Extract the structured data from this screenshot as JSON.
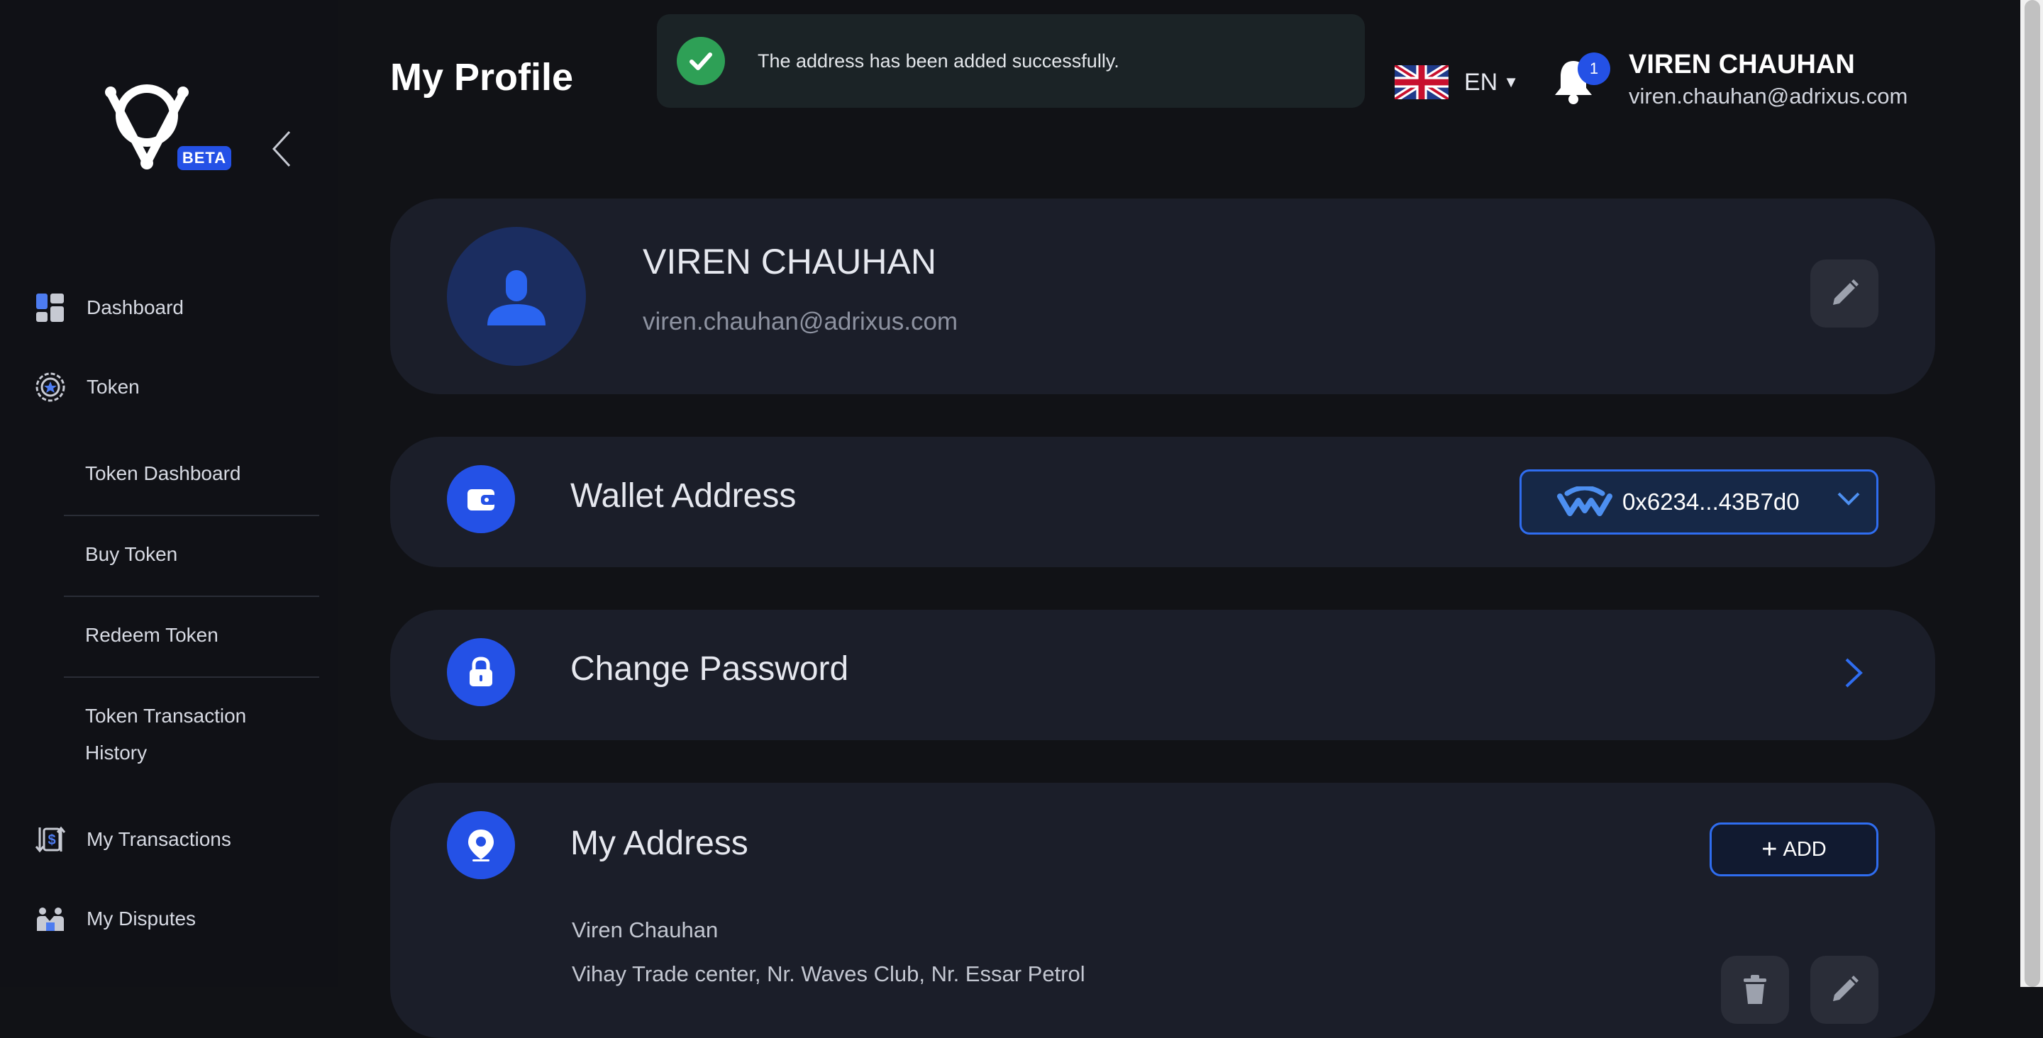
{
  "app": {
    "beta_badge": "BETA"
  },
  "sidebar": {
    "items": [
      {
        "label": "Dashboard",
        "icon": "dashboard-icon"
      },
      {
        "label": "Token",
        "icon": "token-icon"
      },
      {
        "label": "My Transactions",
        "icon": "transactions-icon"
      },
      {
        "label": "My Disputes",
        "icon": "disputes-icon"
      }
    ],
    "token_subitems": [
      "Token Dashboard",
      "Buy Token",
      "Redeem Token",
      "Token Transaction History"
    ]
  },
  "header": {
    "title": "My Profile",
    "language": "EN",
    "notification_count": "1",
    "user_name": "VIREN CHAUHAN",
    "user_email": "viren.chauhan@adrixus.com"
  },
  "toast": {
    "message": "The address has been added successfully."
  },
  "profile": {
    "name": "VIREN CHAUHAN",
    "email": "viren.chauhan@adrixus.com"
  },
  "wallet": {
    "title": "Wallet Address",
    "address": "0x6234...43B7d0"
  },
  "password": {
    "title": "Change Password"
  },
  "address": {
    "title": "My Address",
    "add_label": "ADD",
    "entries": [
      {
        "name": "Viren Chauhan",
        "line": "Vihay Trade center, Nr. Waves Club, Nr. Essar Petrol"
      }
    ]
  },
  "colors": {
    "accent": "#2451e6",
    "success": "#2ea056",
    "card": "#1b1e29",
    "background": "#111216"
  }
}
